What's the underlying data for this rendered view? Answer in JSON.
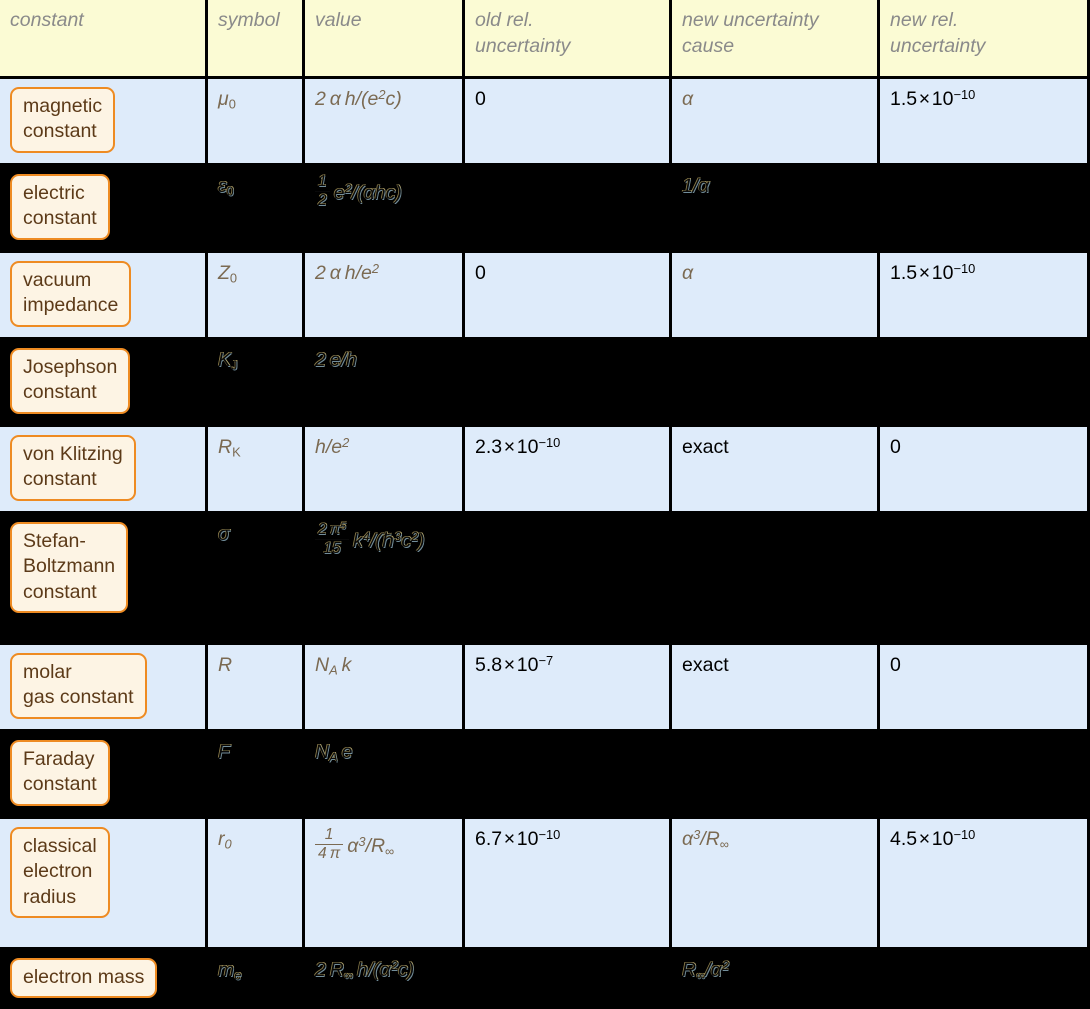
{
  "table": {
    "headers": [
      {
        "line1": "constant",
        "line2": ""
      },
      {
        "line1": "symbol",
        "line2": ""
      },
      {
        "line1": "value",
        "line2": ""
      },
      {
        "line1": "old rel.",
        "line2": "uncertainty"
      },
      {
        "line1": "new uncertainty",
        "line2": "cause"
      },
      {
        "line1": "new rel.",
        "line2": "uncertainty"
      }
    ],
    "rows": [
      {
        "state": "highlighted",
        "name": "magnetic constant",
        "symbol": "μ0",
        "value": "2 α h/(e²c)",
        "old_uncertainty": "0",
        "cause": "α",
        "new_uncertainty": "1.5 × 10⁻¹⁰"
      },
      {
        "state": "dimmed",
        "name": "electric constant",
        "symbol": "ε0",
        "value": "½ e²/(αhc)",
        "old_uncertainty": "",
        "cause": "1/α",
        "new_uncertainty": ""
      },
      {
        "state": "highlighted",
        "name": "vacuum impedance",
        "symbol": "Z0",
        "value": "2 α h/e²",
        "old_uncertainty": "0",
        "cause": "α",
        "new_uncertainty": "1.5 × 10⁻¹⁰"
      },
      {
        "state": "dimmed",
        "name": "Josephson constant",
        "symbol": "KJ",
        "value": "2 e/h",
        "old_uncertainty": "",
        "cause": "",
        "new_uncertainty": ""
      },
      {
        "state": "highlighted",
        "name": "von Klitzing constant",
        "symbol": "RK",
        "value": "h/e²",
        "old_uncertainty": "2.3 × 10⁻¹⁰",
        "cause": "exact",
        "new_uncertainty": "0"
      },
      {
        "state": "dimmed",
        "name": "Stefan-Boltzmann constant",
        "symbol": "σ",
        "value": "(2π⁵/15) k⁴/(ℏ³c²)",
        "old_uncertainty": "",
        "cause": "",
        "new_uncertainty": ""
      },
      {
        "state": "highlighted",
        "name": "molar gas constant",
        "symbol": "R",
        "value": "NA k",
        "old_uncertainty": "5.8 × 10⁻⁷",
        "cause": "exact",
        "new_uncertainty": "0"
      },
      {
        "state": "dimmed",
        "name": "Faraday constant",
        "symbol": "F",
        "value": "NA e",
        "old_uncertainty": "",
        "cause": "",
        "new_uncertainty": ""
      },
      {
        "state": "highlighted",
        "name": "classical electron radius",
        "symbol": "r0",
        "value": "(1/4π) α³/R∞",
        "old_uncertainty": "6.7 × 10⁻¹⁰",
        "cause": "α³/R∞",
        "new_uncertainty": "4.5 × 10⁻¹⁰"
      },
      {
        "state": "dimmed",
        "name": "electron mass",
        "symbol": "me",
        "value": "2 R∞ h/(α²c)",
        "old_uncertainty": "",
        "cause": "R∞/α²",
        "new_uncertainty": ""
      }
    ],
    "name_lines": {
      "magnetic": [
        "magnetic",
        "constant"
      ],
      "electric": [
        "electric",
        "constant"
      ],
      "vacuum": [
        "vacuum",
        "impedance"
      ],
      "josephson": [
        "Josephson",
        "constant"
      ],
      "klitzing": [
        "von Klitzing",
        "constant"
      ],
      "stefan": [
        "Stefan-",
        "Boltzmann",
        "constant"
      ],
      "molar": [
        "molar",
        "gas constant"
      ],
      "faraday": [
        "Faraday",
        "constant"
      ],
      "classical": [
        "classical",
        "electron",
        "radius"
      ],
      "emass": [
        "electron mass"
      ]
    },
    "labels": {
      "exact": "exact",
      "zero": "0",
      "u_1p5": "1.5",
      "u_2p3": "2.3",
      "u_5p8": "5.8",
      "u_6p7": "6.7",
      "u_4p5": "4.5",
      "times": "×",
      "ten": "10",
      "exp_m10": "−10",
      "exp_m7": "−7"
    }
  },
  "colors": {
    "header_bg": "#FBFBD4",
    "header_text": "#8A8A8A",
    "row_highlight_bg": "#DEEBFA",
    "row_dim_bg": "#000000",
    "chip_bg": "#FDF4E4",
    "chip_border": "#EE8B22",
    "chip_text": "#5C3A18",
    "math_text": "#7B6A52",
    "grid": "#000000"
  }
}
